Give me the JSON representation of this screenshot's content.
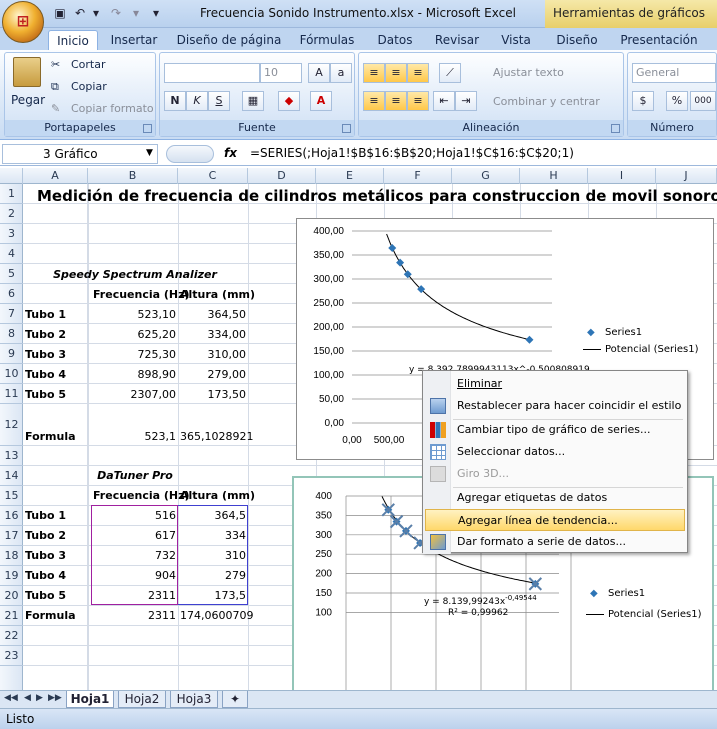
{
  "window": {
    "title": "Frecuencia Sonido Instrumento.xlsx - Microsoft Excel",
    "context_tab": "Herramientas de gráficos"
  },
  "tabs": [
    "Inicio",
    "Insertar",
    "Diseño de página",
    "Fórmulas",
    "Datos",
    "Revisar",
    "Vista",
    "Diseño",
    "Presentación"
  ],
  "ribbon": {
    "paste": "Pegar",
    "cut": "Cortar",
    "copy": "Copiar",
    "format_painter": "Copiar formato",
    "clipboard_group": "Portapapeles",
    "font_size": "10",
    "font_group": "Fuente",
    "bold": "N",
    "italic": "K",
    "underline": "S",
    "wrap_text": "Ajustar texto",
    "merge_center": "Combinar y centrar",
    "alignment_group": "Alineación",
    "number_format": "General",
    "number_group": "Número",
    "percent": "%",
    "thousands": "000"
  },
  "formula_bar": {
    "name_box": "3 Gráfico",
    "fx": "fx",
    "formula": "=SERIES(;Hoja1!$B$16:$B$20;Hoja1!$C$16:$C$20;1)"
  },
  "columns": [
    "A",
    "B",
    "C",
    "D",
    "E",
    "F",
    "G",
    "H",
    "I",
    "J"
  ],
  "rows": [
    "1",
    "2",
    "3",
    "4",
    "5",
    "6",
    "7",
    "8",
    "9",
    "10",
    "11",
    "12",
    "13",
    "14",
    "15",
    "16",
    "17",
    "18",
    "19",
    "20",
    "21",
    "22",
    "23"
  ],
  "sheet": {
    "title": "Medición de frecuencia de cilindros metálicos para construccion de movil sonoro",
    "section1": "Speedy Spectrum Analizer",
    "section2": "DaTuner  Pro",
    "col_freq": "Frecuencia (Hz)",
    "col_height": "Altura (mm)",
    "table1": [
      {
        "label": "Tubo 1",
        "freq": "523,10",
        "height": "364,50"
      },
      {
        "label": "Tubo 2",
        "freq": "625,20",
        "height": "334,00"
      },
      {
        "label": "Tubo 3",
        "freq": "725,30",
        "height": "310,00"
      },
      {
        "label": "Tubo 4",
        "freq": "898,90",
        "height": "279,00"
      },
      {
        "label": "Tubo 5",
        "freq": "2307,00",
        "height": "173,50"
      }
    ],
    "formula_row1": {
      "label": "Formula",
      "freq": "523,1",
      "height": "365,1028921"
    },
    "table2": [
      {
        "label": "Tubo 1",
        "freq": "516",
        "height": "364,5"
      },
      {
        "label": "Tubo 2",
        "freq": "617",
        "height": "334"
      },
      {
        "label": "Tubo 3",
        "freq": "732",
        "height": "310"
      },
      {
        "label": "Tubo 4",
        "freq": "904",
        "height": "279"
      },
      {
        "label": "Tubo 5",
        "freq": "2311",
        "height": "173,5"
      }
    ],
    "formula_row2": {
      "label": "Formula",
      "freq": "2311",
      "height": "174,0600709"
    }
  },
  "chart_data": [
    {
      "type": "scatter",
      "series": [
        {
          "name": "Series1",
          "x": [
            523.1,
            625.2,
            725.3,
            898.9,
            2307
          ],
          "y": [
            364.5,
            334,
            310,
            279,
            173.5
          ]
        }
      ],
      "trendline": "Potencial (Series1)",
      "equation": "y = 8.392,7899943113x^-0,500808919",
      "yticks": [
        "400,00",
        "350,00",
        "300,00",
        "250,00",
        "200,00",
        "150,00",
        "100,00",
        "50,00",
        "0,00"
      ],
      "xticks": [
        "0,00",
        "500,00",
        "1"
      ],
      "ylim": [
        0,
        400
      ]
    },
    {
      "type": "scatter",
      "series": [
        {
          "name": "Series1",
          "x": [
            516,
            617,
            732,
            904,
            2311
          ],
          "y": [
            364.5,
            334,
            310,
            279,
            173.5
          ]
        }
      ],
      "trendline": "Potencial (Series1)",
      "equation": "y = 8.139,99243x",
      "exponent": "-0,49544",
      "r2": "R² = 0,99962",
      "yticks": [
        "400",
        "350",
        "300",
        "250",
        "200",
        "150",
        "100"
      ],
      "ylim": [
        100,
        400
      ]
    }
  ],
  "context_menu": [
    {
      "label": "Eliminar",
      "icon": "delete-icon"
    },
    {
      "label": "Restablecer para hacer coincidir el estilo",
      "icon": "reset-style-icon"
    },
    {
      "label": "Cambiar tipo de gráfico de series...",
      "icon": "chart-type-icon"
    },
    {
      "label": "Seleccionar datos...",
      "icon": "select-data-icon"
    },
    {
      "label": "Giro 3D...",
      "icon": "rotate-3d-icon"
    },
    {
      "label": "Agregar etiquetas de datos",
      "icon": ""
    },
    {
      "label": "Agregar línea de tendencia...",
      "icon": ""
    },
    {
      "label": "Dar formato a serie de datos...",
      "icon": "format-series-icon"
    }
  ],
  "sheet_tabs": [
    "Hoja1",
    "Hoja2",
    "Hoja3"
  ],
  "status": "Listo"
}
